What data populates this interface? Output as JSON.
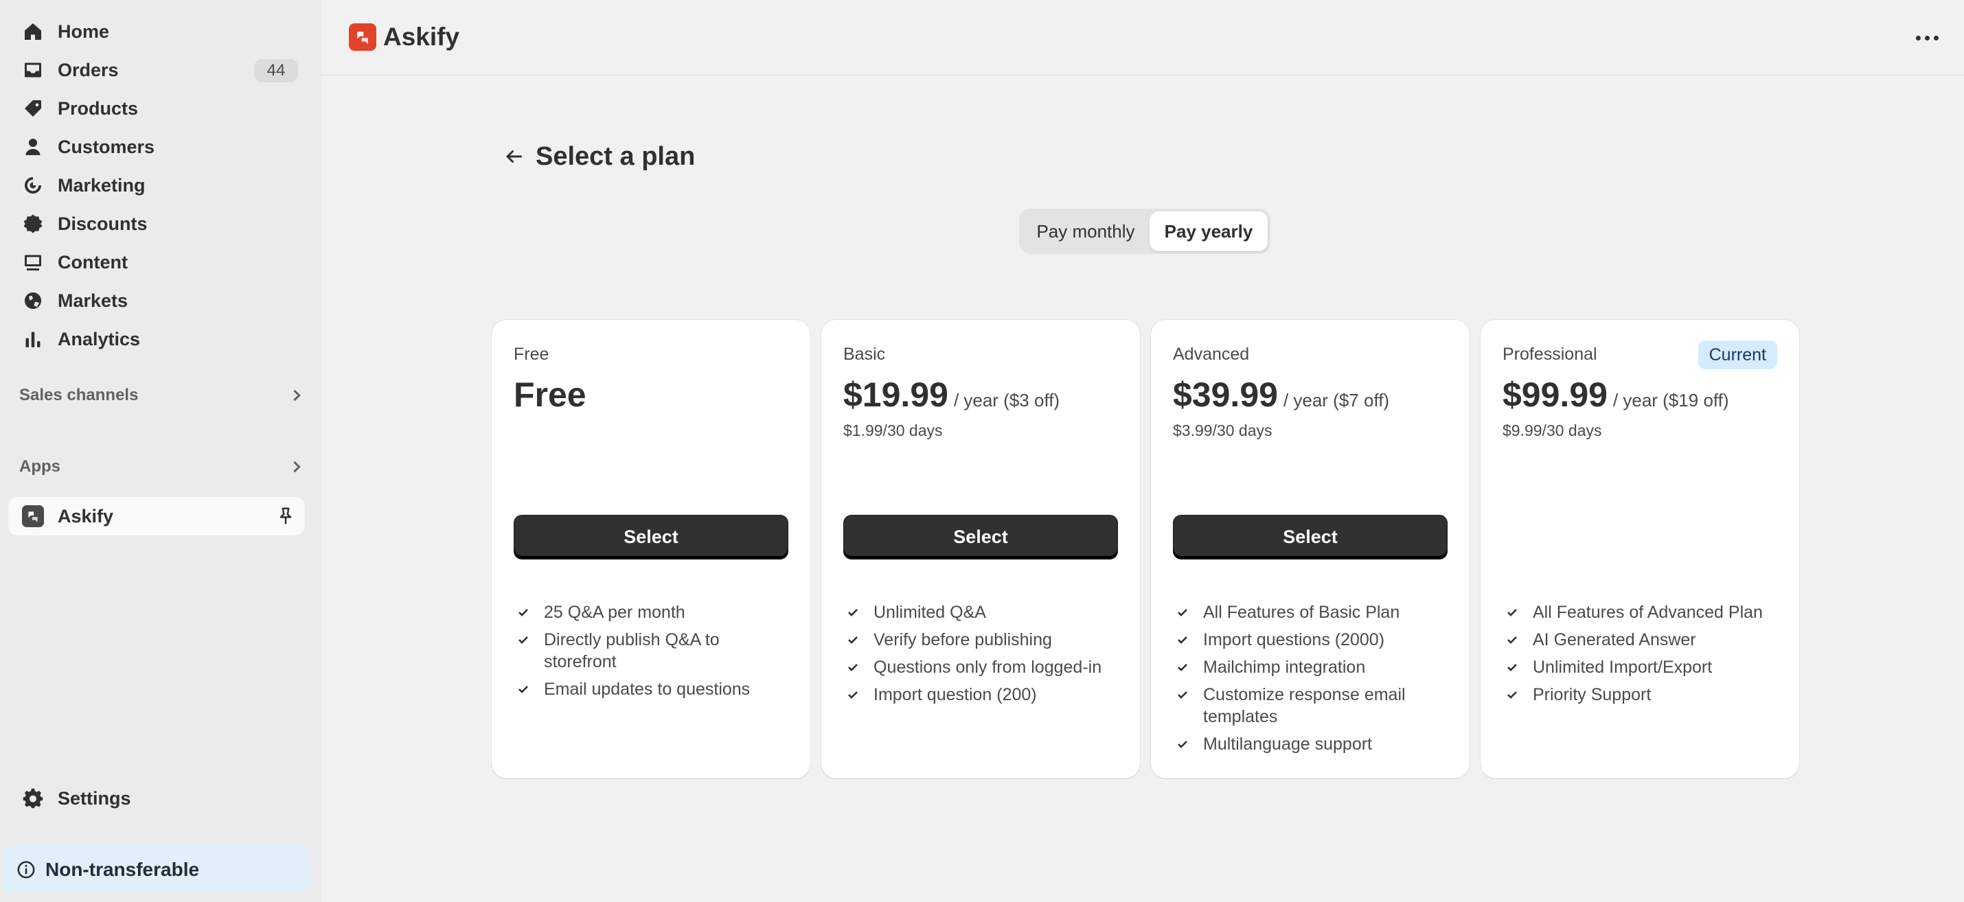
{
  "sidebar": {
    "nav": [
      {
        "label": "Home",
        "icon": "home-icon"
      },
      {
        "label": "Orders",
        "icon": "inbox-icon",
        "badge": "44"
      },
      {
        "label": "Products",
        "icon": "tag-icon"
      },
      {
        "label": "Customers",
        "icon": "person-icon"
      },
      {
        "label": "Marketing",
        "icon": "target-icon"
      },
      {
        "label": "Discounts",
        "icon": "discount-icon"
      },
      {
        "label": "Content",
        "icon": "image-icon"
      },
      {
        "label": "Markets",
        "icon": "globe-icon"
      },
      {
        "label": "Analytics",
        "icon": "bar-chart-icon"
      }
    ],
    "sales_channels": "Sales channels",
    "apps": "Apps",
    "app_item": "Askify",
    "settings": "Settings",
    "non_transferable": "Non-transferable"
  },
  "topbar": {
    "title": "Askify",
    "logo_color": "#e0442d"
  },
  "page": {
    "title": "Select a plan"
  },
  "billing_toggle": {
    "monthly": "Pay monthly",
    "yearly": "Pay yearly",
    "selected": "yearly"
  },
  "plans": [
    {
      "name": "Free",
      "price": "Free",
      "suffix": "",
      "sub": "",
      "button": "Select",
      "features": [
        "25 Q&A per month",
        "Directly publish Q&A to storefront",
        "Email updates to questions"
      ]
    },
    {
      "name": "Basic",
      "price": "$19.99",
      "suffix": "/ year ($3 off)",
      "sub": "$1.99/30 days",
      "button": "Select",
      "features": [
        "Unlimited Q&A",
        "Verify before publishing",
        "Questions only from logged-in",
        "Import question (200)"
      ]
    },
    {
      "name": "Advanced",
      "price": "$39.99",
      "suffix": "/ year ($7 off)",
      "sub": "$3.99/30 days",
      "button": "Select",
      "features": [
        "All Features of Basic Plan",
        "Import questions (2000)",
        "Mailchimp integration",
        "Customize response email templates",
        "Multilanguage support"
      ]
    },
    {
      "name": "Professional",
      "price": "$99.99",
      "suffix": "/ year ($19 off)",
      "sub": "$9.99/30 days",
      "badge": "Current",
      "features": [
        "All Features of Advanced Plan",
        "AI Generated Answer",
        "Unlimited Import/Export",
        "Priority Support"
      ]
    }
  ]
}
